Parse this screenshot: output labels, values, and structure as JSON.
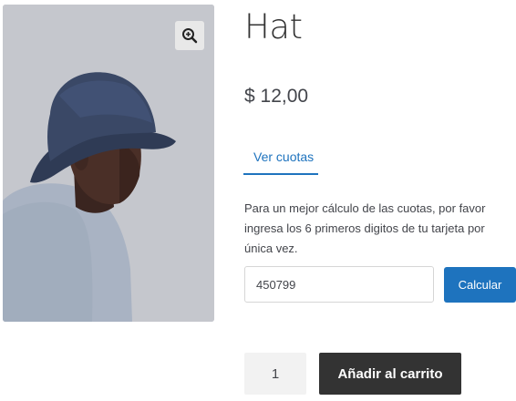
{
  "product": {
    "title": "Hat",
    "price": "$ 12,00",
    "image_alt": "Man wearing a navy bucket hat",
    "zoom_icon": "zoom-in-icon"
  },
  "tabs": [
    {
      "label": "Ver cuotas",
      "active": true
    }
  ],
  "installments": {
    "note": "Para un mejor cálculo de las cuotas, por favor ingresa los 6 primeros digitos de tu tarjeta por única vez.",
    "bin_value": "450799",
    "calculate_label": "Calcular"
  },
  "cart": {
    "quantity": "1",
    "add_to_cart_label": "Añadir al carrito"
  },
  "colors": {
    "accent": "#1e73be",
    "dark_button": "#333333",
    "text": "#43454b"
  }
}
